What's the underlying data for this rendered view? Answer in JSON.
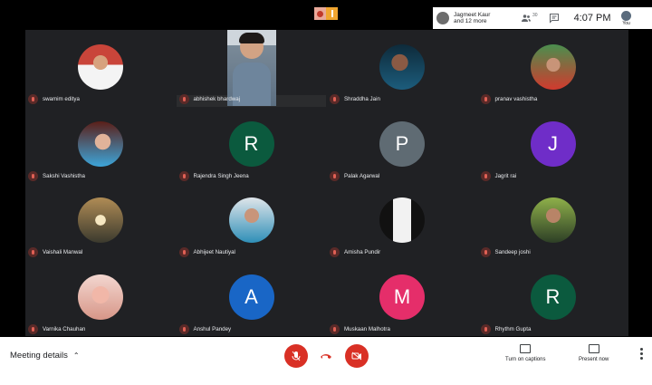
{
  "top": {
    "presenter_line1": "Jagmeet Kaur",
    "presenter_line2": "and 12 more",
    "people_count": "30",
    "time": "4:07 PM",
    "self_label": "You"
  },
  "participants": [
    {
      "name": "swamim editya",
      "avatar_type": "photo",
      "avatar_letter": "",
      "color": ""
    },
    {
      "name": "abhishek bhardwaj",
      "avatar_type": "video",
      "avatar_letter": "",
      "color": ""
    },
    {
      "name": "Shraddha Jain",
      "avatar_type": "photo",
      "avatar_letter": "",
      "color": ""
    },
    {
      "name": "pranav vashistha",
      "avatar_type": "photo",
      "avatar_letter": "",
      "color": ""
    },
    {
      "name": "Sakshi Vashistha",
      "avatar_type": "photo",
      "avatar_letter": "",
      "color": ""
    },
    {
      "name": "Rajendra Singh Jeena",
      "avatar_type": "letter",
      "avatar_letter": "R",
      "color": "#0b5a3e"
    },
    {
      "name": "Palak Agarwal",
      "avatar_type": "letter",
      "avatar_letter": "P",
      "color": "#5f6b73"
    },
    {
      "name": "Jagrit rai",
      "avatar_type": "letter",
      "avatar_letter": "J",
      "color": "#6f2dc8"
    },
    {
      "name": "Vaishali Manwal",
      "avatar_type": "photo",
      "avatar_letter": "",
      "color": ""
    },
    {
      "name": "Abhijeet Nautiyal",
      "avatar_type": "photo",
      "avatar_letter": "",
      "color": ""
    },
    {
      "name": "Amisha Pundir",
      "avatar_type": "photo",
      "avatar_letter": "",
      "color": ""
    },
    {
      "name": "Sandeep joshi",
      "avatar_type": "photo",
      "avatar_letter": "",
      "color": ""
    },
    {
      "name": "Varnika Chauhan",
      "avatar_type": "photo",
      "avatar_letter": "",
      "color": ""
    },
    {
      "name": "Anshul Pandey",
      "avatar_type": "letter",
      "avatar_letter": "A",
      "color": "#1966c6"
    },
    {
      "name": "Muskaan Malhotra",
      "avatar_type": "letter",
      "avatar_letter": "M",
      "color": "#e52e6a"
    },
    {
      "name": "Rhythm Gupta",
      "avatar_type": "letter",
      "avatar_letter": "R",
      "color": "#0b5a3e"
    }
  ],
  "bottom": {
    "meeting_details": "Meeting details",
    "captions": "Turn on captions",
    "present": "Present now"
  },
  "icons": {
    "people": "people-icon",
    "chat": "chat-icon",
    "mic": "mic-off-icon",
    "hangup": "hang-up-icon",
    "camera": "camera-off-icon",
    "captions": "captions-icon",
    "present": "present-icon",
    "more": "more-vert-icon",
    "muted": "mic-muted-icon"
  }
}
